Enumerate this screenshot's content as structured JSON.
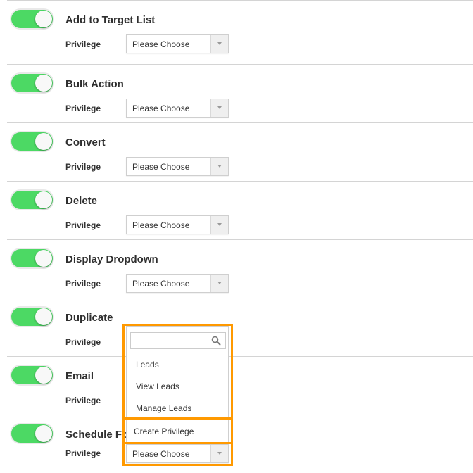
{
  "accent_color": "#4cd964",
  "highlight_color": "#ff9900",
  "rows": [
    {
      "title": "Add to Target List",
      "label": "Privilege",
      "value": "Please Choose",
      "enabled": true
    },
    {
      "title": "Bulk Action",
      "label": "Privilege",
      "value": "Please Choose",
      "enabled": true
    },
    {
      "title": "Convert",
      "label": "Privilege",
      "value": "Please Choose",
      "enabled": true
    },
    {
      "title": "Delete",
      "label": "Privilege",
      "value": "Please Choose",
      "enabled": true
    },
    {
      "title": "Display Dropdown",
      "label": "Privilege",
      "value": "Please Choose",
      "enabled": true
    },
    {
      "title": "Duplicate",
      "label": "Privilege",
      "value": "",
      "enabled": true
    },
    {
      "title": "Email",
      "label": "Privilege",
      "value": "",
      "enabled": true
    },
    {
      "title": "Schedule Fo",
      "label": "Privilege",
      "value": "Please Choose",
      "enabled": true
    }
  ],
  "dropdown": {
    "search_placeholder": "",
    "search_icon": "search-icon",
    "options": [
      "Leads",
      "View Leads",
      "Manage Leads"
    ],
    "create_label": "Create Privilege"
  }
}
